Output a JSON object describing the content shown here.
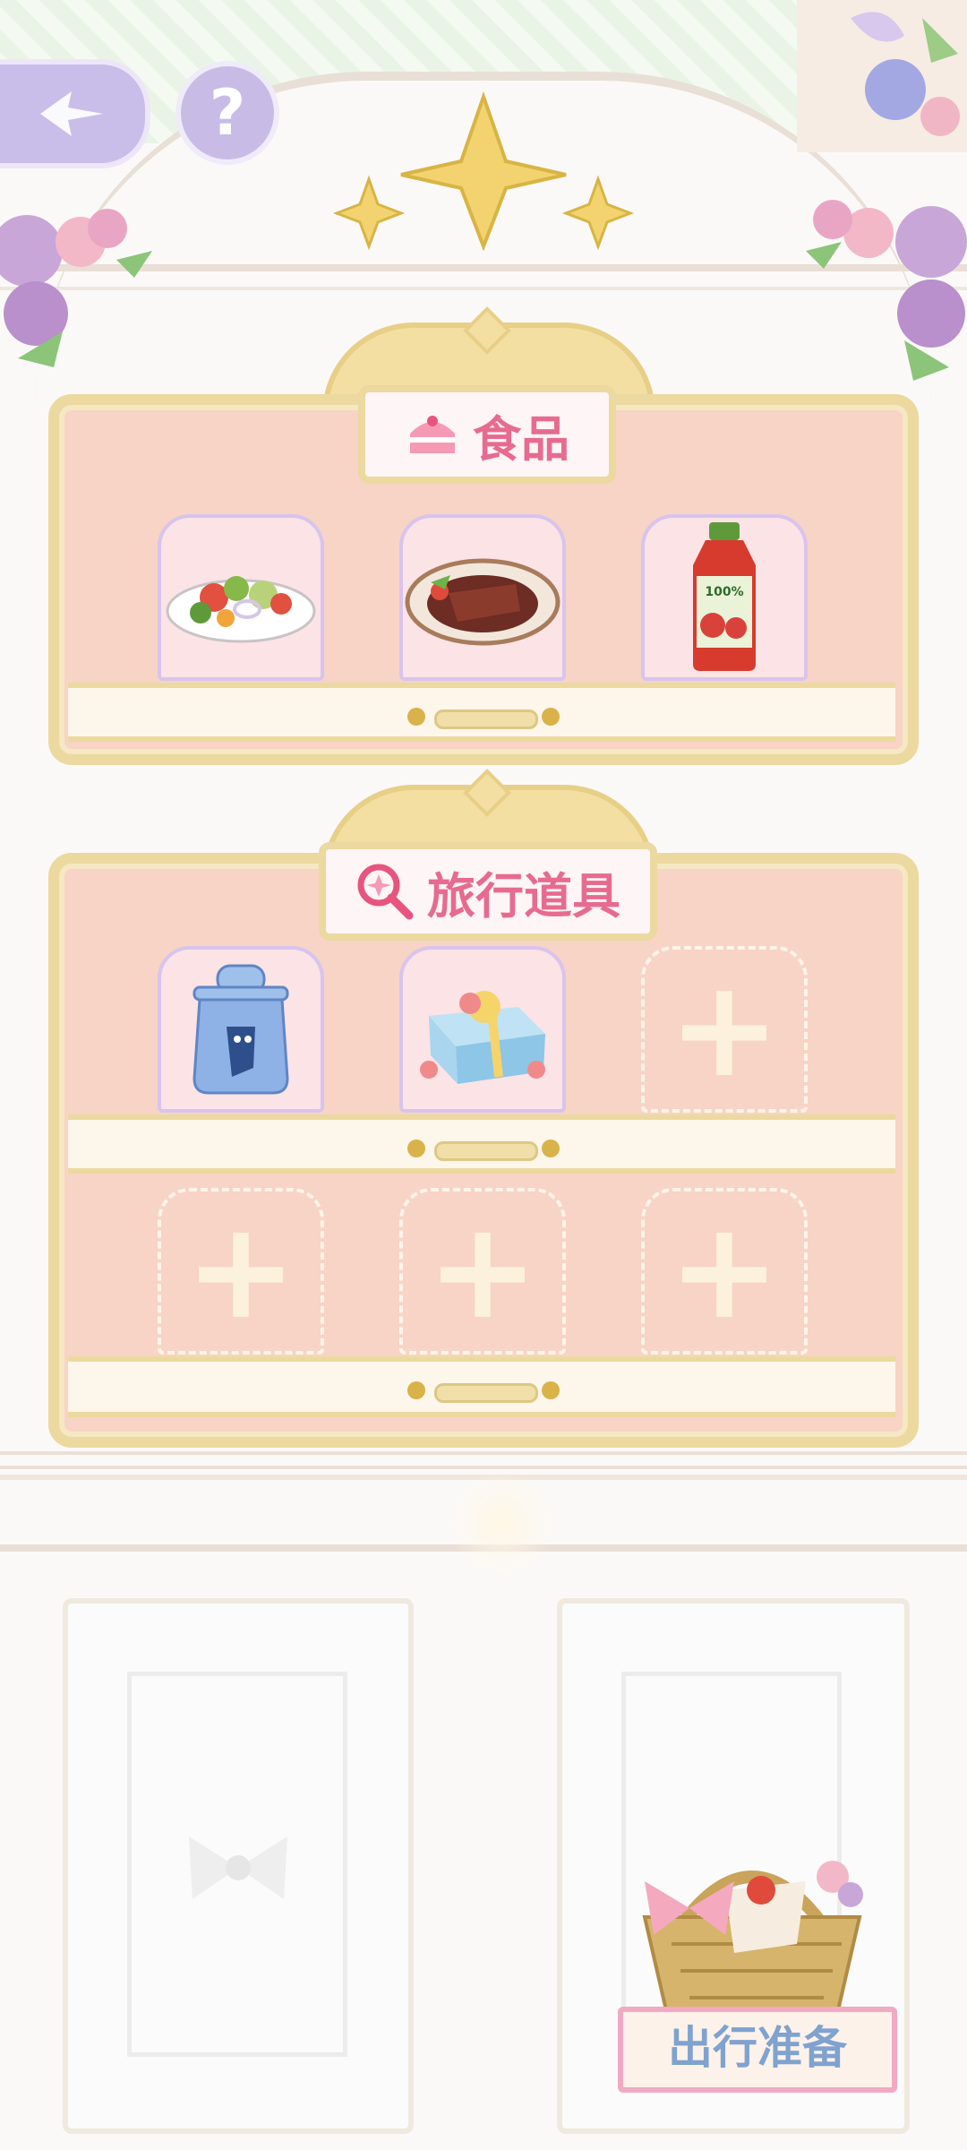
{
  "header": {
    "back_icon": "back-arrow-icon",
    "help_label": "?"
  },
  "food_section": {
    "title": "食品",
    "icon": "cake-icon",
    "items": [
      {
        "name": "salad",
        "icon": "salad-icon"
      },
      {
        "name": "steak",
        "icon": "steak-icon"
      },
      {
        "name": "tomato juice",
        "icon": "juice-bottle-icon",
        "label": "100%"
      }
    ]
  },
  "travel_section": {
    "title": "旅行道具",
    "icon": "magnifier-icon",
    "items": [
      {
        "name": "water bottle",
        "icon": "bottle-icon"
      },
      {
        "name": "gift box",
        "icon": "gift-icon"
      }
    ],
    "empty_slot_label": "+"
  },
  "bottom": {
    "prepare_label": "出行准备",
    "basket_icon": "picnic-basket-icon"
  },
  "colors": {
    "panel": "#f7d4c5",
    "frame": "#ecd9a0",
    "title": "#e76b8f",
    "accent_purple": "#c9bde9"
  }
}
